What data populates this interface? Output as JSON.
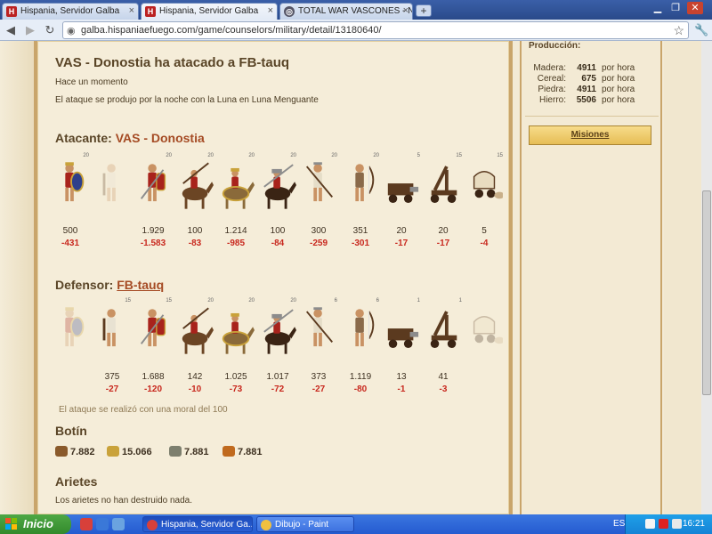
{
  "browser": {
    "tabs": [
      {
        "label": "Hispania, Servidor Galba",
        "fav": "H"
      },
      {
        "label": "Hispania, Servidor Galba",
        "fav": "H"
      },
      {
        "label": "TOTAL WAR  VASCONES - NJC",
        "fav": "◎"
      }
    ],
    "new_tab": "+",
    "url": "galba.hispaniaefuego.com/game/counselors/military/detail/13180640/"
  },
  "report": {
    "title": "VAS - Donostia ha atacado a FB-tauq",
    "time": "Hace un momento",
    "moon": "El ataque se produjo por la noche con la Luna en Luna Menguante"
  },
  "attacker": {
    "label": "Atacante:",
    "name": "VAS - Donostia",
    "units": [
      {
        "icon": "hoplite-icon",
        "level": "20",
        "count": "500",
        "loss": "-431",
        "faded": false
      },
      {
        "icon": "light-infantry-icon",
        "level": "",
        "count": "",
        "loss": "",
        "faded": true
      },
      {
        "icon": "scutarius-icon",
        "level": "20",
        "count": "1.929",
        "loss": "-1.583",
        "faded": false
      },
      {
        "icon": "light-cavalry-icon",
        "level": "20",
        "count": "100",
        "loss": "-83",
        "faded": false
      },
      {
        "icon": "noble-cavalry-icon",
        "level": "20",
        "count": "1.214",
        "loss": "-985",
        "faded": false
      },
      {
        "icon": "heavy-cavalry-icon",
        "level": "20",
        "count": "100",
        "loss": "-84",
        "faded": false
      },
      {
        "icon": "spearman-icon",
        "level": "20",
        "count": "300",
        "loss": "-259",
        "faded": false
      },
      {
        "icon": "archer-icon",
        "level": "20",
        "count": "351",
        "loss": "-301",
        "faded": false
      },
      {
        "icon": "ram-icon",
        "level": "5",
        "count": "20",
        "loss": "-17",
        "faded": false
      },
      {
        "icon": "catapult-icon",
        "level": "15",
        "count": "20",
        "loss": "-17",
        "faded": false
      },
      {
        "icon": "supply-cart-icon",
        "level": "15",
        "count": "5",
        "loss": "-4",
        "faded": false
      }
    ]
  },
  "defender": {
    "label": "Defensor:",
    "name": "FB-tauq",
    "units": [
      {
        "icon": "hoplite-icon",
        "level": "",
        "count": "",
        "loss": "",
        "faded": true
      },
      {
        "icon": "light-infantry-icon",
        "level": "15",
        "count": "375",
        "loss": "-27",
        "faded": false
      },
      {
        "icon": "scutarius-icon",
        "level": "15",
        "count": "1.688",
        "loss": "-120",
        "faded": false
      },
      {
        "icon": "light-cavalry-icon",
        "level": "20",
        "count": "142",
        "loss": "-10",
        "faded": false
      },
      {
        "icon": "noble-cavalry-icon",
        "level": "20",
        "count": "1.025",
        "loss": "-73",
        "faded": false
      },
      {
        "icon": "heavy-cavalry-icon",
        "level": "20",
        "count": "1.017",
        "loss": "-72",
        "faded": false
      },
      {
        "icon": "spearman-icon",
        "level": "6",
        "count": "373",
        "loss": "-27",
        "faded": false
      },
      {
        "icon": "archer-icon",
        "level": "6",
        "count": "1.119",
        "loss": "-80",
        "faded": false
      },
      {
        "icon": "ram-icon",
        "level": "1",
        "count": "13",
        "loss": "-1",
        "faded": false
      },
      {
        "icon": "catapult-icon",
        "level": "1",
        "count": "41",
        "loss": "-3",
        "faded": false
      },
      {
        "icon": "supply-cart-icon",
        "level": "",
        "count": "",
        "loss": "",
        "faded": true
      }
    ]
  },
  "morale": "El ataque se realizó con una moral del 100",
  "loot": {
    "title": "Botín",
    "items": [
      {
        "icon": "wood-icon",
        "value": "7.882",
        "color": "#8a5a2b"
      },
      {
        "icon": "cereal-icon",
        "value": "15.066",
        "color": "#c9a23a"
      },
      {
        "icon": "stone-icon",
        "value": "7.881",
        "color": "#7d7f6e"
      },
      {
        "icon": "iron-icon",
        "value": "7.881",
        "color": "#c06a1e"
      }
    ]
  },
  "rams": {
    "title": "Arietes",
    "text": "Los arietes no han destruido nada."
  },
  "sidebar": {
    "production_title": "Producción:",
    "resources": [
      {
        "name": "Madera:",
        "value": "4911",
        "unit": "por hora"
      },
      {
        "name": "Cereal:",
        "value": "675",
        "unit": "por hora"
      },
      {
        "name": "Piedra:",
        "value": "4911",
        "unit": "por hora"
      },
      {
        "name": "Hierro:",
        "value": "5506",
        "unit": "por hora"
      }
    ],
    "missions_label": "Misiones"
  },
  "taskbar": {
    "start_label": "Inicio",
    "tasks": [
      {
        "label": "Hispania, Servidor Ga..."
      },
      {
        "label": "Dibujo - Paint"
      }
    ],
    "lang": "ES",
    "clock": "16:21"
  }
}
